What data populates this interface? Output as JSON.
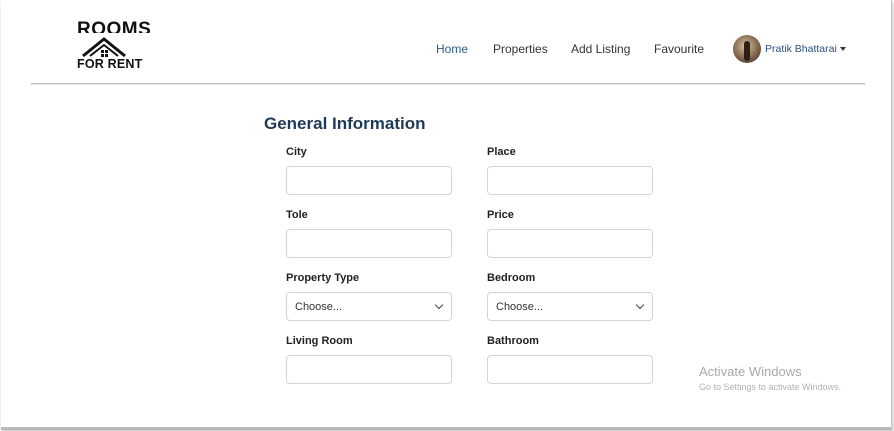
{
  "logo": {
    "top_text": "ROOMS",
    "bottom_text": "FOR RENT",
    "icon": "house-roof-icon"
  },
  "nav": {
    "home": "Home",
    "properties": "Properties",
    "add_listing": "Add Listing",
    "favourite": "Favourite"
  },
  "user": {
    "name": "Pratik Bhattarai"
  },
  "form": {
    "section_title": "General Information",
    "city_label": "City",
    "place_label": "Place",
    "tole_label": "Tole",
    "price_label": "Price",
    "property_type_label": "Property Type",
    "property_type_value": "Choose...",
    "bedroom_label": "Bedroom",
    "bedroom_value": "Choose...",
    "living_room_label": "Living Room",
    "bathroom_label": "Bathroom"
  },
  "watermark": {
    "title": "Activate Windows",
    "subtitle": "Go to Settings to activate Windows."
  }
}
